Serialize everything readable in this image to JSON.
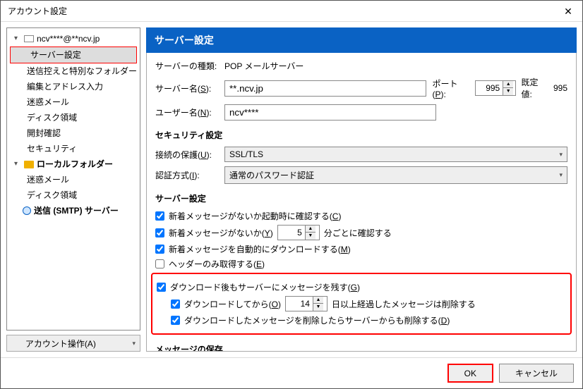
{
  "window": {
    "title": "アカウント設定"
  },
  "tree": {
    "account": "ncv****@**ncv.jp",
    "items": [
      "サーバー設定",
      "送信控えと特別なフォルダー",
      "編集とアドレス入力",
      "迷惑メール",
      "ディスク領域",
      "開封確認",
      "セキュリティ"
    ],
    "local_label": "ローカルフォルダー",
    "local_items": [
      "迷惑メール",
      "ディスク領域"
    ],
    "smtp": "送信 (SMTP) サーバー",
    "actions_label": "アカウント操作(A)"
  },
  "panel": {
    "header": "サーバー設定",
    "type_label": "サーバーの種類:",
    "type_value": "POP メールサーバー",
    "server_label_pre": "サーバー名(",
    "server_label_key": "S",
    "server_label_post": "):",
    "server_value": "**.ncv.jp",
    "port_label_pre": "ポート(",
    "port_label_key": "P",
    "port_label_post": "):",
    "port_value": "995",
    "default_label": "既定値:",
    "default_value": "995",
    "user_label_pre": "ユーザー名(",
    "user_label_key": "N",
    "user_label_post": "):",
    "user_value": "ncv****",
    "security_title": "セキュリティ設定",
    "conn_label_pre": "接続の保護(",
    "conn_label_key": "U",
    "conn_label_post": "):",
    "conn_value": "SSL/TLS",
    "auth_label_pre": "認証方式(",
    "auth_label_key": "I",
    "auth_label_post": "):",
    "auth_value": "通常のパスワード認証",
    "server_settings_title": "サーバー設定",
    "chk1_pre": "新着メッセージがないか起動時に確認する(",
    "chk1_key": "C",
    "chk1_post": ")",
    "chk2_pre": "新着メッセージがないか(",
    "chk2_key": "Y",
    "chk2_post": ")",
    "chk2_interval": "5",
    "chk2_suffix": "分ごとに確認する",
    "chk3_pre": "新着メッセージを自動的にダウンロードする(",
    "chk3_key": "M",
    "chk3_post": ")",
    "chk4_pre": "ヘッダーのみ取得する(",
    "chk4_key": "E",
    "chk4_post": ")",
    "chk5_pre": "ダウンロード後もサーバーにメッセージを残す(",
    "chk5_key": "G",
    "chk5_post": ")",
    "chk6_pre": "ダウンロードしてから(",
    "chk6_key": "O",
    "chk6_post": ")",
    "chk6_days": "14",
    "chk6_suffix": "日以上経過したメッセージは削除する",
    "chk7_pre": "ダウンロードしたメッセージを削除したらサーバーからも削除する(",
    "chk7_key": "D",
    "chk7_post": ")",
    "storage_title": "メッセージの保存"
  },
  "footer": {
    "ok": "OK",
    "cancel": "キャンセル"
  }
}
